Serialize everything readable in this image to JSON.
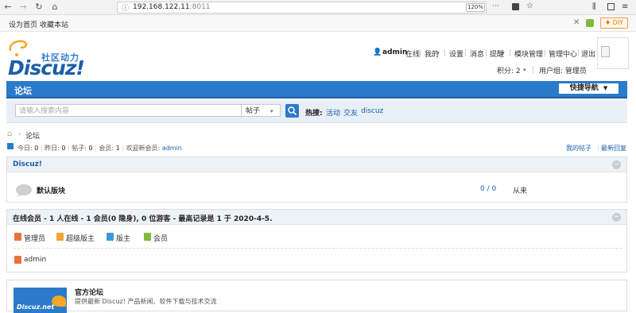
{
  "browser": {
    "url_host": "192.168.122.11",
    "url_port": ":8011",
    "zoom": "120%",
    "icons": [
      "back-icon",
      "forward-icon",
      "reload-icon",
      "home-icon",
      "info-icon",
      "more-icon",
      "pocket-icon",
      "bookmark-star-icon",
      "library-icon",
      "sidebar-icon",
      "menu-icon"
    ]
  },
  "topbar": {
    "set_home": "设为首页",
    "bookmark": "收藏本站",
    "diy": "♦ DIY"
  },
  "logo": {
    "brand": "Discuz!",
    "sub": "社区动力"
  },
  "usermenu": {
    "username": "admin",
    "status": "在线",
    "mine": "我的",
    "settings": "设置",
    "messages": "消息",
    "alerts": "提醒",
    "modules": "模块管理",
    "admin_center": "管理中心",
    "logout": "退出",
    "points": "积分: 2",
    "group": "用户组: 管理员"
  },
  "nav": {
    "forum": "论坛",
    "quick": "快捷导航"
  },
  "search": {
    "placeholder": "请输入搜索内容",
    "type": "帖子",
    "hot_label": "热搜:",
    "hot": [
      "活动",
      "交友",
      "discuz"
    ]
  },
  "breadcrumb": {
    "current": "论坛"
  },
  "stats": {
    "today_label": "今日:",
    "today": "0",
    "yesterday_label": "昨日:",
    "yesterday": "0",
    "posts_label": "帖子:",
    "posts": "0",
    "members_label": "会员:",
    "members": "1",
    "newest_label": "欢迎新会员:",
    "newest": "admin",
    "my_posts": "我的帖子",
    "latest_reply": "最新回复"
  },
  "forum_group": {
    "title": "Discuz!",
    "board_name": "默认版块",
    "counts": "0 / 0",
    "last_post": "从来"
  },
  "online": {
    "title": "在线会员 - 1 人在线 - 1 会员(0 隐身), 0 位游客 - 最高记录是 1 于 2020-4-5.",
    "legend": [
      {
        "label": "管理员",
        "color": "#e8743b"
      },
      {
        "label": "超级版主",
        "color": "#f0a43a"
      },
      {
        "label": "版主",
        "color": "#3a9bd8"
      },
      {
        "label": "会员",
        "color": "#7dbb3c"
      }
    ],
    "users": [
      "admin"
    ]
  },
  "official": {
    "title": "官方论坛",
    "desc": "提供最新 Discuz! 产品新闻、软件下载与技术交流",
    "logo_text": "Discuz.net"
  }
}
